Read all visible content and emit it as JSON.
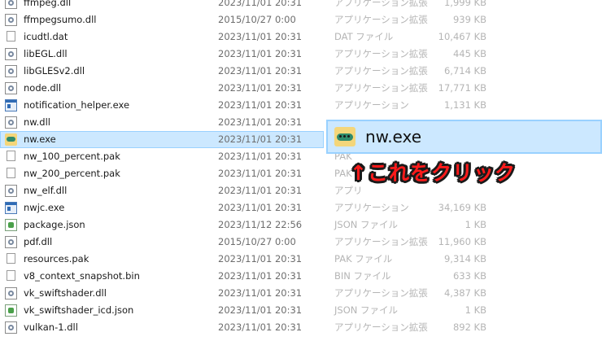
{
  "files": [
    {
      "name": "ffmpeg.dll",
      "date": "2023/11/01 20:31",
      "type": "アプリケーション拡張",
      "size": "1,999 KB",
      "icon": "dll-file-icon"
    },
    {
      "name": "ffmpegsumo.dll",
      "date": "2015/10/27 0:00",
      "type": "アプリケーション拡張",
      "size": "939 KB",
      "icon": "dll-file-icon"
    },
    {
      "name": "icudtl.dat",
      "date": "2023/11/01 20:31",
      "type": "DAT ファイル",
      "size": "10,467 KB",
      "icon": "blank-file-icon"
    },
    {
      "name": "libEGL.dll",
      "date": "2023/11/01 20:31",
      "type": "アプリケーション拡張",
      "size": "445 KB",
      "icon": "dll-file-icon"
    },
    {
      "name": "libGLESv2.dll",
      "date": "2023/11/01 20:31",
      "type": "アプリケーション拡張",
      "size": "6,714 KB",
      "icon": "dll-file-icon"
    },
    {
      "name": "node.dll",
      "date": "2023/11/01 20:31",
      "type": "アプリケーション拡張",
      "size": "17,771 KB",
      "icon": "dll-file-icon"
    },
    {
      "name": "notification_helper.exe",
      "date": "2023/11/01 20:31",
      "type": "アプリケーション",
      "size": "1,131 KB",
      "icon": "exe-file-icon"
    },
    {
      "name": "nw.dll",
      "date": "2023/11/01 20:31",
      "type": "",
      "size": "",
      "icon": "dll-file-icon"
    },
    {
      "name": "nw.exe",
      "date": "2023/11/01 20:31",
      "type": "",
      "size": "",
      "icon": "nw-app-icon",
      "selected": true
    },
    {
      "name": "nw_100_percent.pak",
      "date": "2023/11/01 20:31",
      "type": "PAK",
      "size": "",
      "icon": "blank-file-icon"
    },
    {
      "name": "nw_200_percent.pak",
      "date": "2023/11/01 20:31",
      "type": "PAK",
      "size": "",
      "icon": "blank-file-icon"
    },
    {
      "name": "nw_elf.dll",
      "date": "2023/11/01 20:31",
      "type": "アプリ",
      "size": "",
      "icon": "dll-file-icon"
    },
    {
      "name": "nwjc.exe",
      "date": "2023/11/01 20:31",
      "type": "アプリケーション",
      "size": "34,169 KB",
      "icon": "exe-file-icon"
    },
    {
      "name": "package.json",
      "date": "2023/11/12 22:56",
      "type": "JSON ファイル",
      "size": "1 KB",
      "icon": "json-file-icon"
    },
    {
      "name": "pdf.dll",
      "date": "2015/10/27 0:00",
      "type": "アプリケーション拡張",
      "size": "11,960 KB",
      "icon": "dll-file-icon"
    },
    {
      "name": "resources.pak",
      "date": "2023/11/01 20:31",
      "type": "PAK ファイル",
      "size": "9,314 KB",
      "icon": "blank-file-icon"
    },
    {
      "name": "v8_context_snapshot.bin",
      "date": "2023/11/01 20:31",
      "type": "BIN ファイル",
      "size": "633 KB",
      "icon": "blank-file-icon"
    },
    {
      "name": "vk_swiftshader.dll",
      "date": "2023/11/01 20:31",
      "type": "アプリケーション拡張",
      "size": "4,387 KB",
      "icon": "dll-file-icon"
    },
    {
      "name": "vk_swiftshader_icd.json",
      "date": "2023/11/01 20:31",
      "type": "JSON ファイル",
      "size": "1 KB",
      "icon": "json-file-icon"
    },
    {
      "name": "vulkan-1.dll",
      "date": "2023/11/01 20:31",
      "type": "アプリケーション拡張",
      "size": "892 KB",
      "icon": "dll-file-icon"
    }
  ],
  "popup": {
    "label": "nw.exe",
    "icon": "nw-app-icon"
  },
  "annotation": {
    "text": "↑これをクリック",
    "color": "#ff1a1a"
  },
  "colors": {
    "selection": "#cce8ff",
    "selection_border": "#99d1ff"
  }
}
